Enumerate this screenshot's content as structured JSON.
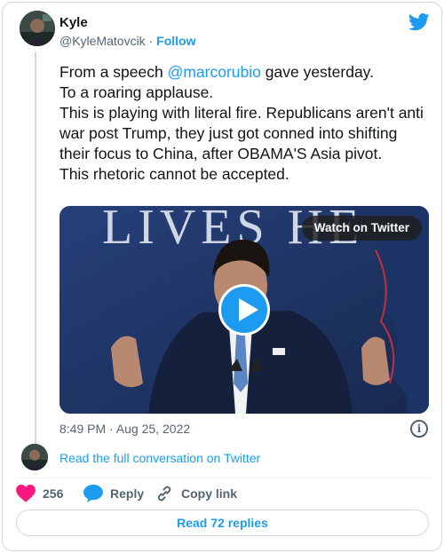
{
  "author": {
    "name": "Kyle",
    "handle": "@KyleMatovcik",
    "separator": "·",
    "follow_label": "Follow"
  },
  "tweet": {
    "text_prefix": "From a speech ",
    "mention": "@marcorubio",
    "text_after_mention": " gave yesterday.",
    "line2": "To a roaring applause.",
    "line3": "This is playing with literal fire. Republicans aren't anti war post Trump, they just got conned into shifting their focus to China, after OBAMA'S Asia pivot.",
    "line4": "This rhetoric cannot be accepted."
  },
  "media": {
    "watch_label": "Watch on Twitter",
    "backdrop_text": "LIVES HE"
  },
  "meta": {
    "timestamp": "8:49 PM · Aug 25, 2022",
    "full_conversation": "Read the full conversation on Twitter"
  },
  "actions": {
    "like_count": "256",
    "reply_label": "Reply",
    "copy_label": "Copy link",
    "read_replies": "Read 72 replies"
  },
  "colors": {
    "accent": "#1d9bf0",
    "like": "#f91880",
    "text": "#0f1419",
    "muted": "#536471"
  },
  "icons": [
    "twitter-bird-icon",
    "play-icon",
    "info-icon",
    "heart-icon",
    "reply-bubble-icon",
    "link-icon"
  ]
}
